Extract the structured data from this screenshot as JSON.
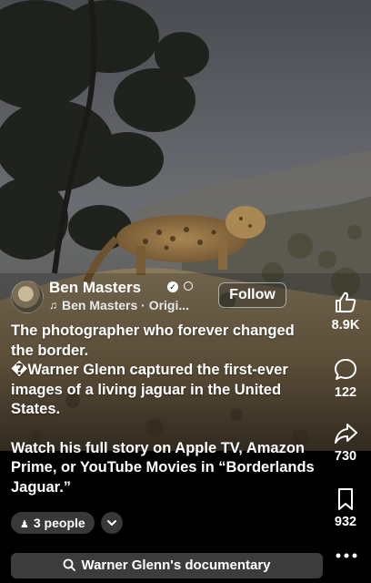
{
  "post": {
    "author": "Ben Masters",
    "audio_label": "Ben Masters · Origi...",
    "follow_label": "Follow",
    "caption_lines": [
      "The photographer who forever changed the border.",
      "�Warner Glenn captured the first-ever images of a living jaguar in the United States.",
      "Watch his full story on Apple TV, Amazon Prime, or YouTube Movies in “Borderlands Jaguar.”"
    ],
    "people_label": "3 people",
    "search_label": "Warner Glenn's documentary"
  },
  "actions": {
    "likes": "8.9K",
    "comments": "122",
    "shares": "730",
    "saves": "932"
  },
  "icons": {
    "verified": "verified-badge-icon",
    "visibility": "globe-icon",
    "audio": "music-note-icon",
    "people": "person-icon",
    "expand": "chevron-down-icon",
    "search": "search-icon",
    "like": "thumbs-up-icon",
    "comment": "comment-bubble-icon",
    "share": "share-arrow-icon",
    "save": "bookmark-icon",
    "more": "more-horizontal-icon"
  },
  "colors": {
    "background": "#000000",
    "text": "#ffffff",
    "chip_bg": "rgba(255,255,255,0.22)",
    "search_bg": "#464646"
  }
}
